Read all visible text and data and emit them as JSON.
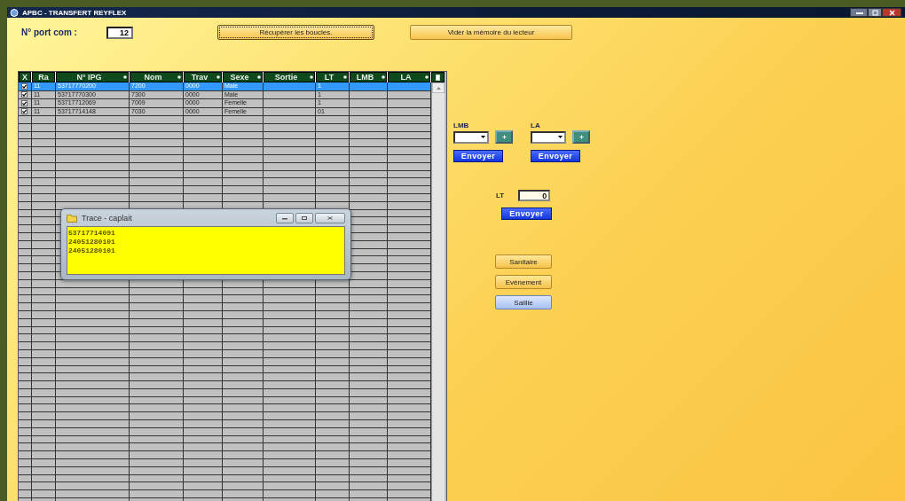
{
  "window": {
    "title": "APBC - TRANSFERT REYFLEX"
  },
  "port": {
    "label": "N° port com :",
    "value": "12"
  },
  "toolbar_buttons": [
    {
      "label": "Récupérer les boucles.",
      "focused": true
    },
    {
      "label": "Vider la mémoire du lecteur",
      "focused": false
    }
  ],
  "table": {
    "columns": [
      {
        "kind": "check",
        "label": "X",
        "sort_marker": false
      },
      {
        "kind": "text",
        "label": "Ra",
        "sort_marker": false
      },
      {
        "kind": "text",
        "label": "N° IPG",
        "sort_marker": true
      },
      {
        "kind": "text",
        "label": "Nom",
        "sort_marker": true
      },
      {
        "kind": "text",
        "label": "Trav",
        "sort_marker": true
      },
      {
        "kind": "text",
        "label": "Sexe",
        "sort_marker": true
      },
      {
        "kind": "text",
        "label": "Sortie",
        "sort_marker": true
      },
      {
        "kind": "text",
        "label": "LT",
        "sort_marker": true
      },
      {
        "kind": "text",
        "label": "LMB",
        "sort_marker": true
      },
      {
        "kind": "text",
        "label": "LA",
        "sort_marker": true
      }
    ],
    "rows": [
      {
        "checked": true,
        "selected": true,
        "cells": [
          "",
          "11",
          "53717770200",
          "7200",
          "0000",
          "Male",
          null,
          "1",
          null,
          null
        ]
      },
      {
        "checked": true,
        "selected": false,
        "cells": [
          "",
          "11",
          "53717770300",
          "7300",
          "0000",
          "Male",
          null,
          "1",
          null,
          null
        ]
      },
      {
        "checked": true,
        "selected": false,
        "cells": [
          "",
          "11",
          "53717712069",
          "7009",
          "0000",
          "Femelle",
          null,
          "1",
          null,
          null
        ]
      },
      {
        "checked": true,
        "selected": false,
        "cells": [
          "",
          "11",
          "53717714148",
          "7030",
          "0000",
          "Femelle",
          null,
          "01",
          null,
          null
        ]
      }
    ]
  },
  "trace": {
    "title": "Trace - caplait",
    "lines": [
      "53717714091",
      "24051280101",
      "24051280101"
    ]
  },
  "side": {
    "senders": [
      {
        "label": "LMB",
        "button": "Envoyer"
      },
      {
        "label": "LA",
        "button": "Envoyer"
      }
    ],
    "lt": {
      "label": "LT",
      "value": "0",
      "button": "Envoyer"
    },
    "actions": [
      {
        "label": "Sanitaire",
        "selected": false
      },
      {
        "label": "Evènement",
        "selected": false
      },
      {
        "label": "Saillie",
        "selected": true
      }
    ]
  }
}
